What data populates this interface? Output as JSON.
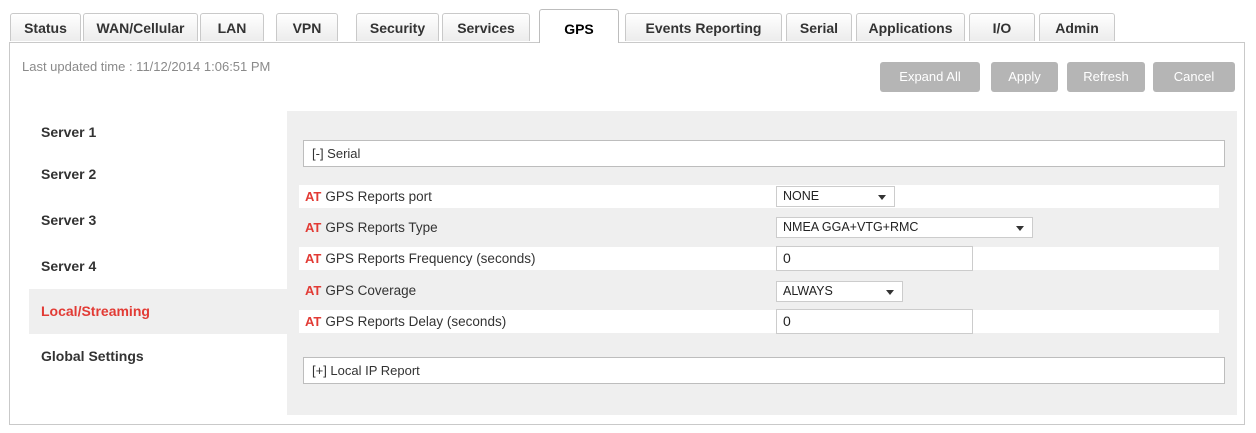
{
  "tabs": [
    {
      "label": "Status"
    },
    {
      "label": "WAN/Cellular"
    },
    {
      "label": "LAN"
    },
    {
      "label": "VPN"
    },
    {
      "label": "Security"
    },
    {
      "label": "Services"
    },
    {
      "label": "GPS"
    },
    {
      "label": "Events Reporting"
    },
    {
      "label": "Serial"
    },
    {
      "label": "Applications"
    },
    {
      "label": "I/O"
    },
    {
      "label": "Admin"
    }
  ],
  "header": {
    "last_updated": "Last updated time : 11/12/2014 1:06:51 PM"
  },
  "toolbar": {
    "expand_all": "Expand All",
    "apply": "Apply",
    "refresh": "Refresh",
    "cancel": "Cancel"
  },
  "sidebar": {
    "items": [
      {
        "label": "Server 1"
      },
      {
        "label": "Server 2"
      },
      {
        "label": "Server 3"
      },
      {
        "label": "Server 4"
      },
      {
        "label": "Local/Streaming"
      },
      {
        "label": "Global Settings"
      }
    ]
  },
  "sections": {
    "serial": "[-] Serial",
    "local_ip": "[+] Local IP Report"
  },
  "at_marker": "AT",
  "fields": {
    "reports_port": {
      "label": "GPS Reports port",
      "value": "NONE"
    },
    "reports_type": {
      "label": "GPS Reports Type",
      "value": "NMEA GGA+VTG+RMC"
    },
    "reports_frequency": {
      "label": "GPS Reports Frequency (seconds)",
      "value": "0"
    },
    "coverage": {
      "label": "GPS Coverage",
      "value": "ALWAYS"
    },
    "reports_delay": {
      "label": "GPS Reports Delay (seconds)",
      "value": "0"
    }
  },
  "colors": {
    "accent_red": "#e23b35",
    "button_gray": "#b5b5b5"
  }
}
